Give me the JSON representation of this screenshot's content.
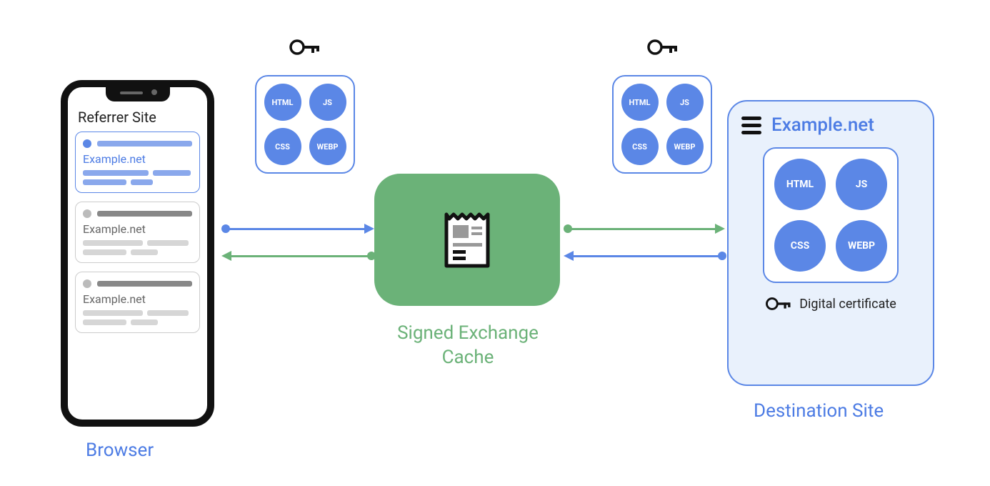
{
  "browser": {
    "referrer_title": "Referrer Site",
    "cards": [
      {
        "site_label": "Example.net"
      },
      {
        "site_label": "Example.net"
      },
      {
        "site_label": "Example.net"
      }
    ],
    "label": "Browser"
  },
  "bundles": {
    "items": [
      "HTML",
      "JS",
      "CSS",
      "WEBP"
    ]
  },
  "cache": {
    "label": "Signed Exchange Cache"
  },
  "destination": {
    "title": "Example.net",
    "digital_cert_label": "Digital certificate",
    "label": "Destination Site"
  },
  "colors": {
    "blue": "#5b87e6",
    "green": "#6bb278",
    "lightblue": "#e9f1fc"
  }
}
